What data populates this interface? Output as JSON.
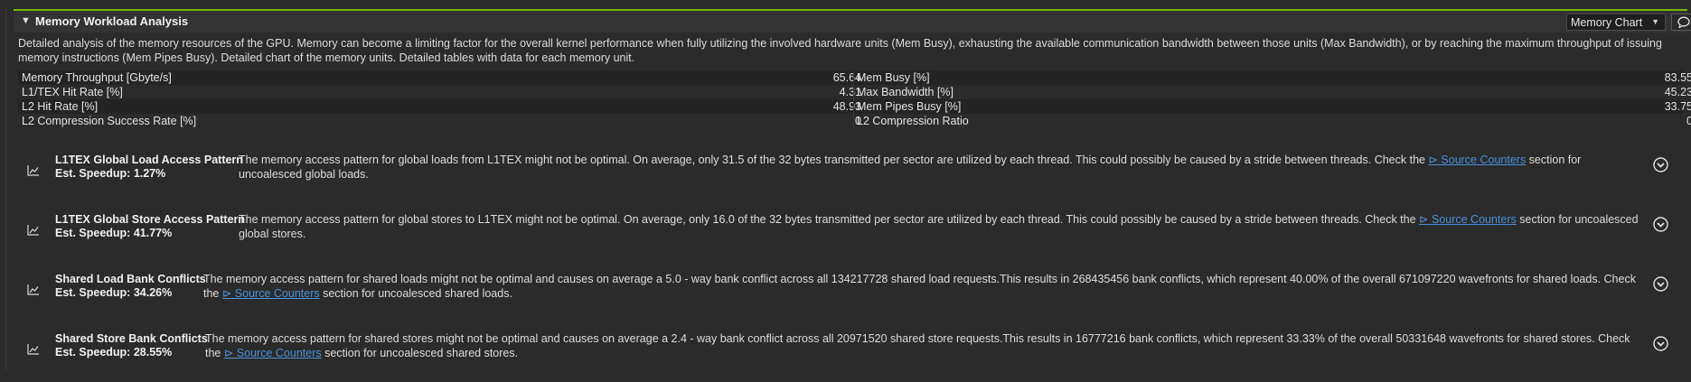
{
  "section": {
    "title": "Memory Workload Analysis",
    "chart_select": "Memory Chart",
    "description": "Detailed analysis of the memory resources of the GPU. Memory can become a limiting factor for the overall kernel performance when fully utilizing the involved hardware units (Mem Busy), exhausting the available communication bandwidth between those units (Max Bandwidth), or by reaching the maximum throughput of issuing memory instructions (Mem Pipes Busy). Detailed chart of the memory units. Detailed tables with data for each memory unit."
  },
  "metrics": [
    {
      "label_left": "Memory Throughput [Gbyte/s]",
      "value_left": "65.64",
      "label_right": "Mem Busy [%]",
      "value_right": "83.55"
    },
    {
      "label_left": "L1/TEX Hit Rate [%]",
      "value_left": "4.31",
      "label_right": "Max Bandwidth [%]",
      "value_right": "45.23"
    },
    {
      "label_left": "L2 Hit Rate [%]",
      "value_left": "48.93",
      "label_right": "Mem Pipes Busy [%]",
      "value_right": "33.75"
    },
    {
      "label_left": "L2 Compression Success Rate [%]",
      "value_left": "0",
      "label_right": "L2 Compression Ratio",
      "value_right": "0"
    }
  ],
  "recommendations": [
    {
      "title": "L1TEX Global Load Access Pattern",
      "speedup": "Est. Speedup: 1.27%",
      "text_before": "The memory access pattern for global loads from L1TEX might not be optimal. On average, only 31.5 of the 32 bytes transmitted per sector are utilized by each thread. This could possibly be caused by a stride between threads. Check the ",
      "link": "⊳ Source Counters",
      "text_after": " section for uncoalesced global loads."
    },
    {
      "title": "L1TEX Global Store Access Pattern",
      "speedup": "Est. Speedup: 41.77%",
      "text_before": "The memory access pattern for global stores to L1TEX might not be optimal. On average, only 16.0 of the 32 bytes transmitted per sector are utilized by each thread. This could possibly be caused by a stride between threads. Check the ",
      "link": "⊳ Source Counters",
      "text_after": " section for uncoalesced global stores."
    },
    {
      "title": "Shared Load Bank Conflicts",
      "speedup": "Est. Speedup: 34.26%",
      "text_before": "The memory access pattern for shared loads might not be optimal and causes on average a 5.0 - way bank conflict across all 134217728 shared load requests.This results in 268435456 bank conflicts, which represent 40.00% of the overall 671097220 wavefronts for shared loads. Check the ",
      "link": "⊳ Source Counters",
      "text_after": " section for uncoalesced shared loads."
    },
    {
      "title": "Shared Store Bank Conflicts",
      "speedup": "Est. Speedup: 28.55%",
      "text_before": "The memory access pattern for shared stores might not be optimal and causes on average a 2.4 - way bank conflict across all 20971520 shared store requests.This results in 16777216 bank conflicts, which represent 33.33% of the overall 50331648 wavefronts for shared stores. Check the ",
      "link": "⊳ Source Counters",
      "text_after": " section for uncoalesced shared stores."
    }
  ]
}
